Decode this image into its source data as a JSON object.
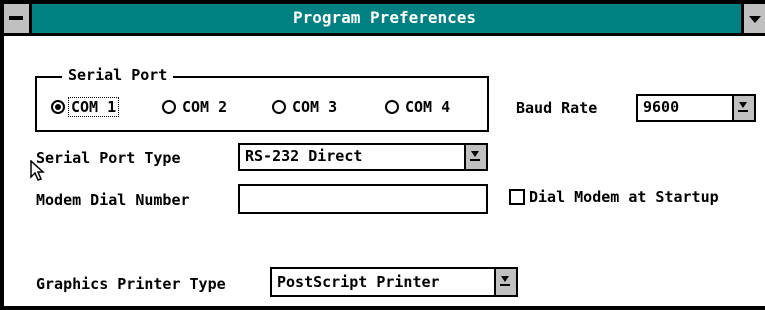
{
  "window": {
    "title": "Program Preferences"
  },
  "serial_port": {
    "legend": "Serial Port",
    "options": [
      "COM 1",
      "COM 2",
      "COM 3",
      "COM 4"
    ],
    "selected": "COM 1"
  },
  "baud_rate": {
    "label": "Baud Rate",
    "value": "9600"
  },
  "serial_port_type": {
    "label": "Serial Port Type",
    "value": "RS-232 Direct"
  },
  "modem_dial_number": {
    "label": "Modem Dial Number",
    "value": ""
  },
  "dial_modem_at_startup": {
    "label": "Dial Modem at Startup",
    "checked": false
  },
  "graphics_printer_type": {
    "label": "Graphics Printer Type",
    "value": "PostScript Printer"
  },
  "icons": [
    "system-menu-icon",
    "scroll-down-icon",
    "radio-icon",
    "dropdown-arrow-icon",
    "mouse-pointer-icon"
  ],
  "colors": {
    "titlebar": "#008080",
    "title_text": "#ffffff",
    "button_face": "#c0c0c0"
  }
}
